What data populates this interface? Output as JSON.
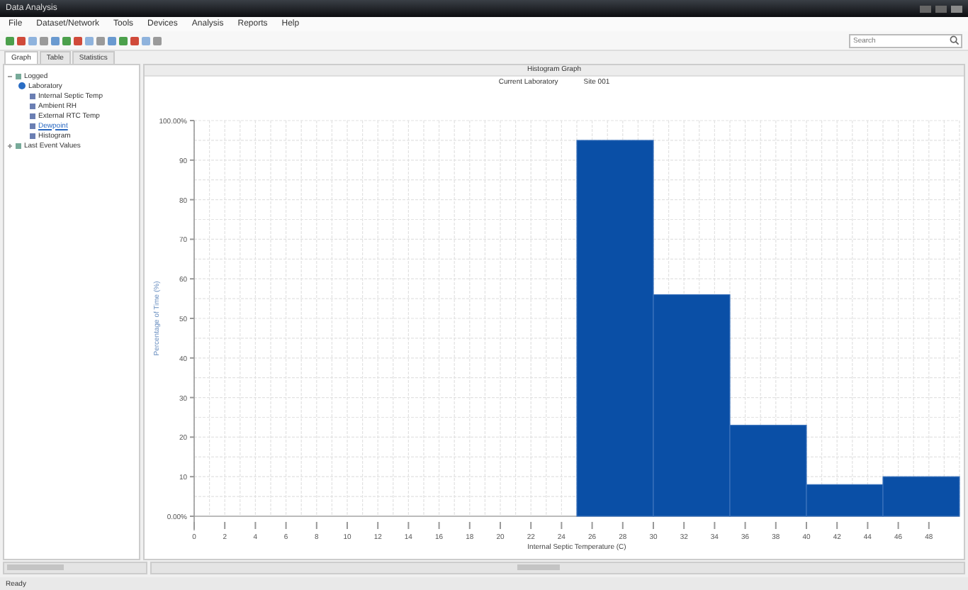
{
  "window": {
    "title": "Data Analysis"
  },
  "menu": [
    "File",
    "Dataset/Network",
    "Tools",
    "Devices",
    "Analysis",
    "Reports",
    "Help"
  ],
  "search": {
    "placeholder": "Search"
  },
  "tabs": [
    {
      "label": "Graph",
      "selected": true
    },
    {
      "label": "Table",
      "selected": false
    },
    {
      "label": "Statistics",
      "selected": false
    }
  ],
  "tree": [
    {
      "label": "Logged",
      "expanded": true,
      "selected": false,
      "children": [
        {
          "label": "Laboratory",
          "expanded": true,
          "selected": false,
          "children": [
            {
              "label": "Internal Septic Temp",
              "selected": false
            },
            {
              "label": "Ambient RH",
              "selected": false
            },
            {
              "label": "External RTC Temp",
              "selected": false
            },
            {
              "label": "Dewpoint",
              "selected": true
            },
            {
              "label": "Histogram",
              "selected": false
            }
          ]
        }
      ]
    },
    {
      "label": "Last Event Values",
      "expanded": false,
      "selected": false
    }
  ],
  "chart_header": "Histogram Graph",
  "chart_subtitle": [
    "Current Laboratory",
    "Site 001"
  ],
  "chart_data": {
    "type": "bar",
    "xlabel": "Internal Septic Temperature (C)",
    "ylabel": "Percentage of Time (%)",
    "x": [
      27.5,
      32.5,
      37.5,
      42.5,
      47.5
    ],
    "values": [
      95,
      56,
      23,
      8,
      10
    ],
    "grid": true,
    "xlim": [
      0,
      50
    ],
    "ylim": [
      0,
      100
    ],
    "xticks": [
      0,
      2,
      4,
      6,
      8,
      10,
      12,
      14,
      16,
      18,
      20,
      22,
      24,
      26,
      28,
      30,
      32,
      34,
      36,
      38,
      40,
      42,
      44,
      46,
      48
    ],
    "yticks": [
      {
        "value": 0,
        "label": "0.00%"
      },
      10,
      20,
      30,
      40,
      50,
      60,
      70,
      80,
      90,
      {
        "value": 100,
        "label": "100.00%"
      }
    ]
  },
  "status": "Ready"
}
